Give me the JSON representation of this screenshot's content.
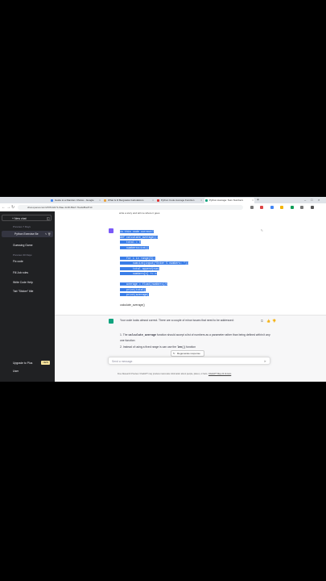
{
  "browser": {
    "tabs": [
      {
        "label": "Guide to a Random Choice - Google",
        "favicon_color": "#4285f4",
        "active": false
      },
      {
        "label": "What Is D Bergsieka Calculations",
        "favicon_color": "#e8a23b",
        "active": false
      },
      {
        "label": "Python Code Average Function",
        "favicon_color": "#d33",
        "active": false
      },
      {
        "label": "Python Average: Sum Numbers",
        "favicon_color": "#10a37f",
        "active": true
      }
    ],
    "new_tab": "+",
    "address": "chat.openai.com/c/57b4cb71-f9ae-4c18-83a7-7be4af5ad714"
  },
  "sidebar": {
    "new_chat": "+ New chat",
    "group_labels": [
      "Previous 7 Days",
      "Previous 30 Days"
    ],
    "items": [
      {
        "label": "Python Exercise Be",
        "active": true
      },
      {
        "label": "Guessing Game",
        "active": false
      },
      {
        "label": "Fix code",
        "active": false
      },
      {
        "label": "Fill Job roles",
        "active": false
      },
      {
        "label": "Write Code Help",
        "active": false
      },
      {
        "label": "Tab \"Sticker\" title",
        "active": false
      }
    ],
    "upgrade_label": "Upgrade to Plus",
    "upgrade_badge": "NEW",
    "user_label": "User"
  },
  "chat": {
    "truncated_header": "write a story and tell me where it goes",
    "user_code_lines": [
      "is this code correct?",
      "def calculate_average():",
      "    total = 0",
      "    numberss=int()",
      "",
      "    for i in range(5):",
      "        num=int(input(\"Enter 5 numbers: \"))",
      "        total.append(num)",
      "        numbers[i] += n",
      "",
      "    average = float(numbers)/5",
      "    print(total)",
      "    print(average)"
    ],
    "user_call": "calculate_average()",
    "assistant_intro": "Your code looks almost correct. There are a couple of minor issues that need to be addressed:",
    "assistant_point1_a": "1.  The ",
    "assistant_point1_code": "calculate_average",
    "assistant_point1_b": " function should accept a list of numbers as a parameter rather than being defined within it any one function",
    "assistant_point2_a": "2.  Instead of using a fixed range",
    "assistant_point2_b": " is can use the ",
    "assistant_point2_code": "len()",
    "assistant_point2_c": " function",
    "regenerate_label": "Regenerate response",
    "input_placeholder": "Send a message.",
    "footer_text": "Free Research Preview. ChatGPT may produce inaccurate information about people, places, or facts.",
    "footer_link": "ChatGPT May 24 Version"
  },
  "colors": {
    "sidebar_bg": "#202123",
    "selection": "#3b7ee8",
    "assistant_avatar": "#10a37f",
    "user_avatar": "#7a5af8"
  }
}
